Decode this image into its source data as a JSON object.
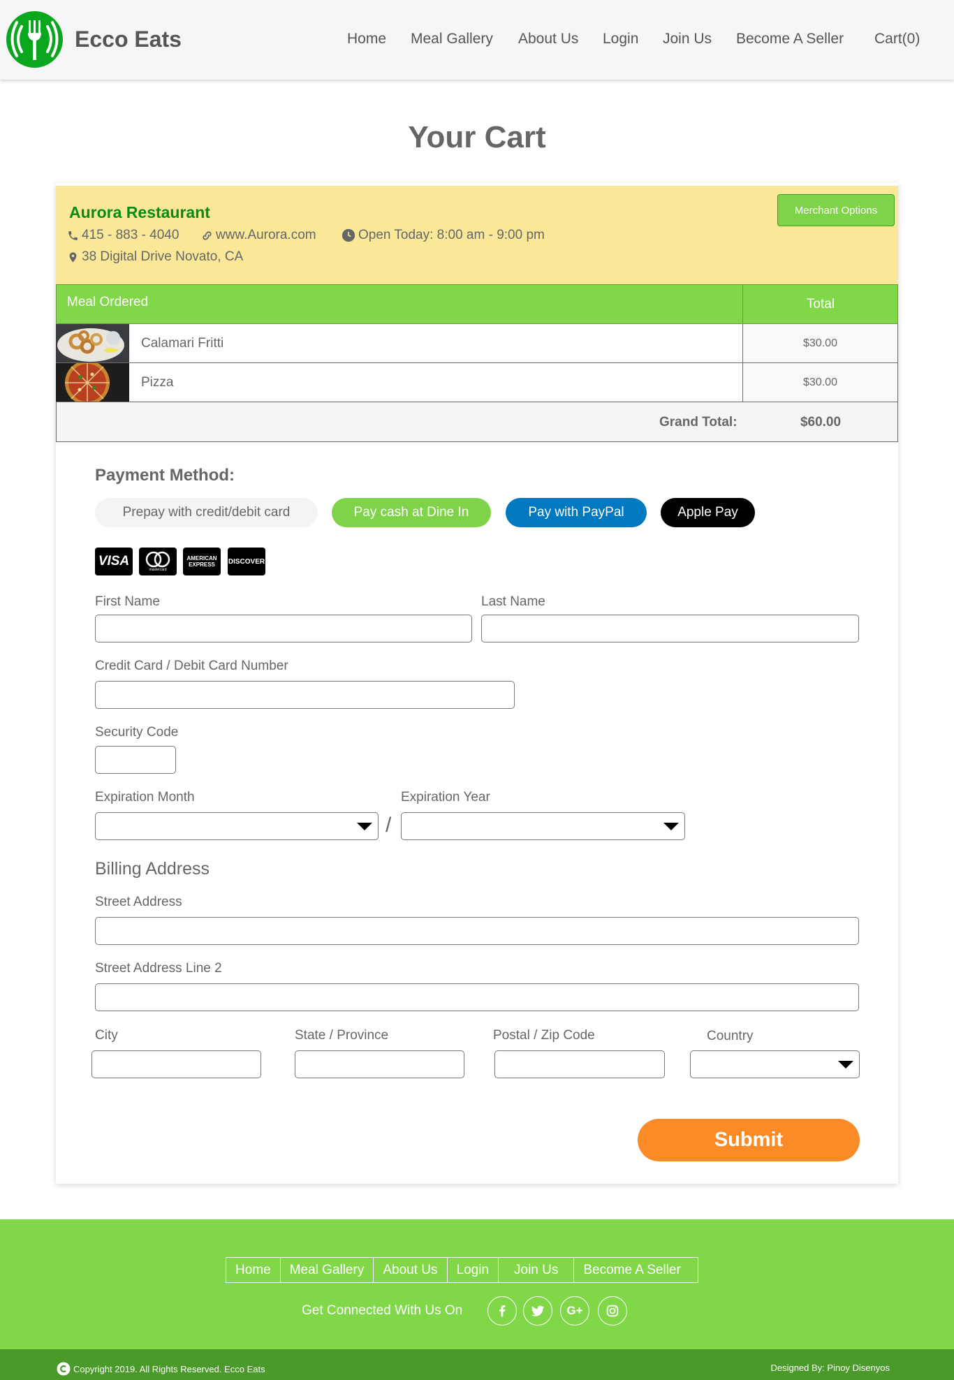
{
  "header": {
    "brand": "Ecco Eats",
    "nav": [
      "Home",
      "Meal Gallery",
      "About Us",
      "Login",
      "Join Us",
      "Become A Seller",
      "Cart(0)"
    ]
  },
  "page_title": "Your Cart",
  "restaurant": {
    "name": "Aurora Restaurant",
    "phone": "415 - 883 - 4040",
    "website": "www.Aurora.com",
    "hours": "Open Today: 8:00 am - 9:00 pm",
    "address": "38 Digital Drive Novato, CA",
    "merchant_options_label": "Merchant Options"
  },
  "table": {
    "col_meal": "Meal Ordered",
    "col_total": "Total",
    "rows": [
      {
        "name": "Calamari Fritti",
        "price": "$30.00"
      },
      {
        "name": "Pizza",
        "price": "$30.00"
      }
    ],
    "grand_total_label": "Grand Total:",
    "grand_total_value": "$60.00"
  },
  "payment": {
    "title": "Payment Method:",
    "options": [
      "Prepay with credit/debit card",
      "Pay cash at Dine In",
      "Pay with PayPal",
      "Apple Pay"
    ],
    "cards": [
      "VISA",
      "mastercard",
      "AMERICAN EXPRESS",
      "DISCOVER"
    ],
    "selected": "Pay cash at Dine In"
  },
  "form": {
    "first_name": "First Name",
    "last_name": "Last Name",
    "card_number": "Credit Card / Debit Card Number",
    "security_code": "Security Code",
    "exp_month": "Expiration Month",
    "exp_year": "Expiration Year",
    "billing_title": "Billing Address",
    "street": "Street Address",
    "street2": "Street Address Line 2",
    "city": "City",
    "state": "State / Province",
    "postal": "Postal / Zip Code",
    "country": "Country",
    "submit_label": "Submit"
  },
  "footer": {
    "nav": [
      "Home",
      "Meal Gallery",
      "About Us",
      "Login",
      "Join Us",
      "Become A Seller"
    ],
    "connected": "Get Connected With Us On",
    "social": [
      "facebook-icon",
      "twitter-icon",
      "google-plus-icon",
      "instagram-icon"
    ],
    "copyright": "Copyright 2019. All Rights Reserved. Ecco Eats",
    "designed_by": "Designed By: Pinoy Disenyos"
  },
  "colors": {
    "green_accent": "#80d849",
    "brand_green": "#0aa61d",
    "restaurant_panel": "#f9e897",
    "paypal_blue": "#0079c1",
    "submit_orange": "#fb8b27",
    "footer_dark": "#4a9a2a"
  }
}
